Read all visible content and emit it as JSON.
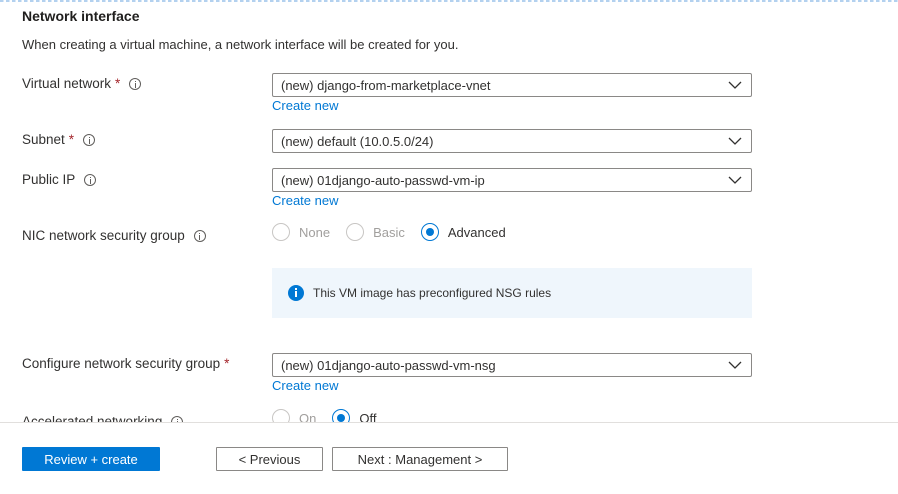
{
  "section": {
    "title": "Network interface",
    "description": "When creating a virtual machine, a network interface will be created for you."
  },
  "fields": {
    "virtual_network": {
      "label": "Virtual network",
      "required": "*",
      "value": "(new) django-from-marketplace-vnet",
      "create_new": "Create new"
    },
    "subnet": {
      "label": "Subnet",
      "required": "*",
      "value": "(new) default (10.0.5.0/24)"
    },
    "public_ip": {
      "label": "Public IP",
      "value": "(new) 01django-auto-passwd-vm-ip",
      "create_new": "Create new"
    },
    "nic_nsg": {
      "label": "NIC network security group",
      "options": [
        {
          "label": "None",
          "state": "disabled"
        },
        {
          "label": "Basic",
          "state": "disabled"
        },
        {
          "label": "Advanced",
          "state": "checked"
        }
      ]
    },
    "nsg_info": "This VM image has preconfigured NSG rules",
    "configure_nsg": {
      "label": "Configure network security group",
      "required": "*",
      "value": "(new) 01django-auto-passwd-vm-nsg",
      "create_new": "Create new"
    },
    "accelerated_networking": {
      "label": "Accelerated networking",
      "options": [
        {
          "label": "On",
          "state": "disabled"
        },
        {
          "label": "Off",
          "state": "checked"
        }
      ]
    }
  },
  "footer": {
    "review_create": "Review + create",
    "previous": "< Previous",
    "next": "Next : Management >"
  },
  "colors": {
    "accent": "#0078d4",
    "required": "#a4262c",
    "info_bg": "#eff6fc"
  },
  "icons": {
    "dropdown": "chevron-down-icon",
    "info": "info-icon",
    "info_filled": "info-filled-icon"
  }
}
